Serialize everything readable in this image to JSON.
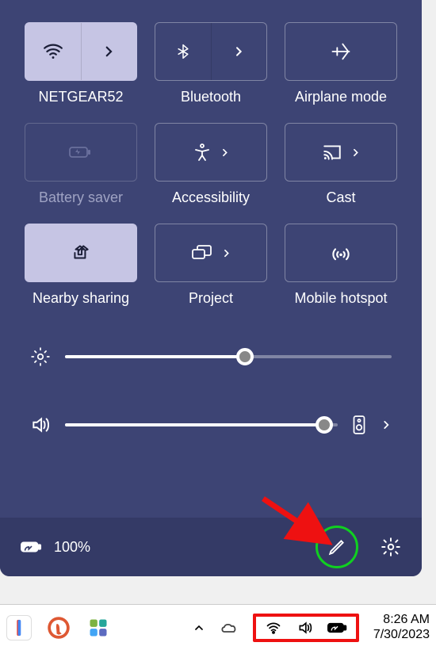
{
  "tiles": {
    "wifi": {
      "label": "NETGEAR52"
    },
    "bluetooth": {
      "label": "Bluetooth"
    },
    "airplane": {
      "label": "Airplane mode"
    },
    "battery": {
      "label": "Battery saver"
    },
    "accessibility": {
      "label": "Accessibility"
    },
    "cast": {
      "label": "Cast"
    },
    "nearby": {
      "label": "Nearby sharing"
    },
    "project": {
      "label": "Project"
    },
    "hotspot": {
      "label": "Mobile hotspot"
    }
  },
  "sliders": {
    "brightness_percent": 55,
    "volume_percent": 95
  },
  "footer": {
    "battery_text": "100%"
  },
  "clock": {
    "time": "8:26 AM",
    "date": "7/30/2023"
  },
  "colors": {
    "panel_bg": "#3d4474",
    "active_tile": "#c6c5e4",
    "highlight_stroke": "#10d020",
    "callout_stroke": "#e11"
  }
}
